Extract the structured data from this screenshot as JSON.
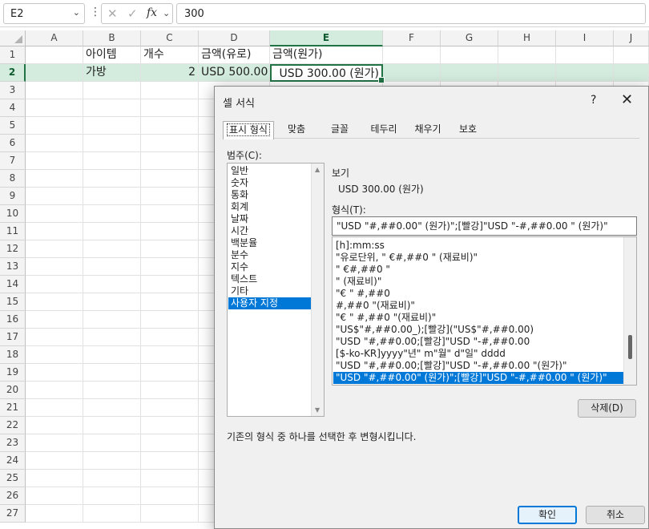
{
  "formula_bar": {
    "name_box": "E2",
    "formula": "300"
  },
  "sheet": {
    "columns": [
      "A",
      "B",
      "C",
      "D",
      "E",
      "F",
      "G",
      "H",
      "I",
      "J"
    ],
    "rows": [
      "1",
      "2",
      "3",
      "4",
      "5",
      "6",
      "7",
      "8",
      "9",
      "10",
      "11",
      "12",
      "13",
      "14",
      "15",
      "16",
      "17",
      "18",
      "19",
      "20",
      "21",
      "22",
      "23",
      "24",
      "25",
      "26",
      "27"
    ],
    "cells": {
      "B1": "아이템",
      "C1": "개수",
      "D1": "금액(유로)",
      "E1": "금액(원가)",
      "B2": "가방",
      "C2": "2",
      "D2": "USD 500.00",
      "E2": "USD 300.00 (원가)"
    }
  },
  "dialog": {
    "title": "셀 서식",
    "help": "?",
    "close": "✕",
    "tabs": [
      "표시 형식",
      "맞춤",
      "글꼴",
      "테두리",
      "채우기",
      "보호"
    ],
    "category_label": "범주(C):",
    "categories": [
      "일반",
      "숫자",
      "통화",
      "회계",
      "날짜",
      "시간",
      "백분율",
      "분수",
      "지수",
      "텍스트",
      "기타",
      "사용자 지정"
    ],
    "selected_category": "사용자 지정",
    "preview_label": "보기",
    "preview_value": "USD 300.00 (원가)",
    "type_label": "형식(T):",
    "type_value": "\"USD \"#,##0.00\" (원가)\";[빨강]\"USD \"-#,##0.00 \" (원가)\"",
    "formats": [
      "[h]:mm:ss",
      "\"유로단위, \" €#,##0 \" (재료비)\"",
      "\" €#,##0 \"",
      "\" (재료비)\"",
      "\"€ \" #,##0",
      "#,##0 \"(재료비)\"",
      "\"€ \" #,##0 \"(재료비)\"",
      "\"US$\"#,##0.00_);[빨강](\"US$\"#,##0.00)",
      "\"USD \"#,##0.00;[빨강]\"USD \"-#,##0.00",
      "[$-ko-KR]yyyy\"년\" m\"월\" d\"일\" dddd",
      "\"USD \"#,##0.00;[빨강]\"USD \"-#,##0.00 \"(원가)\"",
      "\"USD \"#,##0.00\" (원가)\";[빨강]\"USD \"-#,##0.00 \" (원가)\""
    ],
    "delete_button": "삭제(D)",
    "description": "기존의 형식 중 하나를 선택한 후 변형시킵니다.",
    "ok_button": "확인",
    "cancel_button": "취소"
  }
}
